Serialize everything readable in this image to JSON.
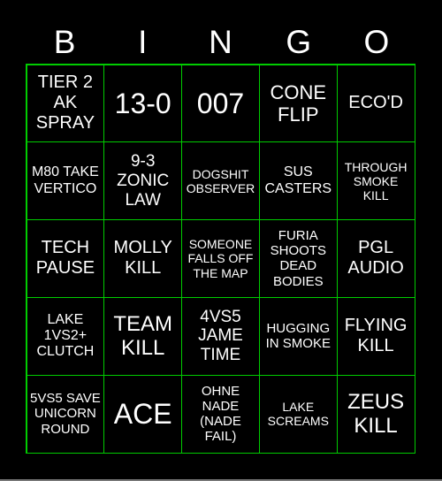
{
  "header": [
    "B",
    "I",
    "N",
    "G",
    "O"
  ],
  "colors": {
    "background": "#000000",
    "grid_line": "#00cc00",
    "text": "#ffffff"
  },
  "cells": [
    "TIER 2 AK SPRAY",
    "13-0",
    "007",
    "CONE FLIP",
    "ECO'D",
    "M80 TAKE VERTICO",
    "9-3 ZONIC LAW",
    "DOGSHIT OBSERVER",
    "SUS CASTERS",
    "THROUGH SMOKE KILL",
    "TECH PAUSE",
    "MOLLY KILL",
    "SOMEONE FALLS OFF THE MAP",
    "FURIA SHOOTS DEAD BODIES",
    "PGL AUDIO",
    "LAKE 1VS2+ CLUTCH",
    "TEAM KILL",
    "4VS5 JAME TIME",
    "HUGGING IN SMOKE",
    "FLYING KILL",
    "5VS5 SAVE UNICORN ROUND",
    "ACE",
    "OHNE NADE (NADE FAIL)",
    "LAKE SCREAMS",
    "ZEUS KILL"
  ]
}
